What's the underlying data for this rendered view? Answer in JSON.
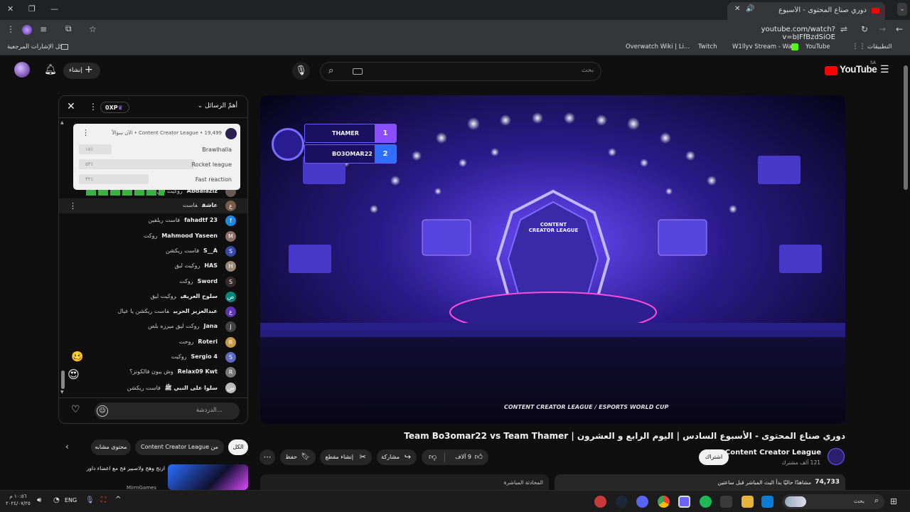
{
  "browser": {
    "tab_title": "دوري صناع المحتوى - الأسبوع",
    "url": "youtube.com/watch?v=bJFfBzdSiOE",
    "bookmarks_all": "كل الإشارات المرجعية",
    "bookmarks": [
      "التطبيقات",
      "YouTube",
      "W1llyv Stream - Wa...",
      "Twitch",
      "Overwatch Wiki | Li..."
    ]
  },
  "header": {
    "create_label": "إنشاء",
    "search_placeholder": "بحث",
    "logo_text": "YouTube",
    "logo_region": "SA"
  },
  "chat": {
    "title": "أهمّ الرسائل",
    "xp_badge": "0XP",
    "poll": {
      "header": "Content Creator League • 19,499 • الآن سؤالاً",
      "options": [
        {
          "label": "Brawlhalla",
          "percent": "٪١٥",
          "fill": 0.15
        },
        {
          "label": "Rocket league",
          "percent": "٪٥٣",
          "fill": 0.53
        },
        {
          "label": "Fast reaction",
          "percent": "٪٣٢",
          "fill": 0.32
        }
      ]
    },
    "partial_row": {
      "author": "Abdalaziz",
      "message": "روكيت ليق"
    },
    "messages": [
      {
        "author": "عاشق",
        "message": "فاست",
        "initial": "ع",
        "color": "#7a5c4a"
      },
      {
        "author": "fahadtf 23",
        "message": "فاست ريلفين",
        "initial": "f",
        "color": "#1e88e5"
      },
      {
        "author": "Mahmood Yaseen",
        "message": "روكت",
        "initial": "M",
        "color": "#8e6e66"
      },
      {
        "author": "S__A",
        "message": "فاست ريكشن",
        "initial": "S",
        "color": "#3949ab"
      },
      {
        "author": "HAS",
        "message": "روكيت ليق",
        "initial": "H",
        "color": "#9e8a74"
      },
      {
        "author": "Sword",
        "message": "روكت",
        "initial": "S",
        "color": "#3b2a2a"
      },
      {
        "author": "سلوح العريفي",
        "message": "روكيت ليق",
        "initial": "ص",
        "color": "#00897b"
      },
      {
        "author": "عبدالعزيز الحربي",
        "message": "فاست ريكشن يا عيال",
        "initial": "ع",
        "color": "#5e35b1"
      },
      {
        "author": "Jana",
        "message": "روكت ليق ميرزه بلص",
        "initial": "J",
        "color": "#444"
      },
      {
        "author": "Roteri",
        "message": "روحت",
        "initial": "R",
        "color": "#c99a4a"
      },
      {
        "author": "Sergio 4",
        "message": "روكيت",
        "initial": "S",
        "color": "#5c6bc0"
      },
      {
        "author": "Relax09 Kwt",
        "message": "وش يبون فالكونز؟",
        "initial": "R",
        "color": "#777"
      },
      {
        "author": "سلوا على النبي ﷺ",
        "message": "فاست ريكشن",
        "initial": "س",
        "color": "#bbb"
      }
    ],
    "input_placeholder": "الدردشة..."
  },
  "video": {
    "scoreboard": [
      {
        "team": "THAMER",
        "score": "1"
      },
      {
        "team": "BO3OMAR22",
        "score": "2"
      }
    ],
    "stage_logo": "CONTENT CREATOR LEAGUE",
    "watermark": "CONTENT CREATOR LEAGUE / ESPORTS WORLD CUP",
    "title": "دوري صناع المحتوى - الأسبوع السادس | اليوم الرابع و العشرون | Team Bo3omar22 vs Team Thamer",
    "channel": "Content Creator League",
    "subscribers": "121 ألف مشترك",
    "subscribe_label": "اشتراك",
    "likes": "9 آلاف",
    "share_label": "مشاركة",
    "clip_label": "إنشاء مقطع",
    "save_label": "حفظ",
    "viewers": "74,733",
    "viewers_text": "مشاهدًا حاليًا  بدأ البث المباشر قبل ساعتين",
    "live_chat_label": "المحادثة المباشرة"
  },
  "related": {
    "chips": [
      "الكل",
      "من Content Creator League",
      "محتوى مشابه"
    ],
    "card_title": "ارنج وهج ولاصبير فج مع اعضاء داور",
    "card_channel": "MirmGames"
  },
  "taskbar": {
    "search_label": "بحث",
    "language": "ENG",
    "time": "١٠:٥٦ م",
    "date": "٢٠٢٤/٠٧/٢٥"
  }
}
